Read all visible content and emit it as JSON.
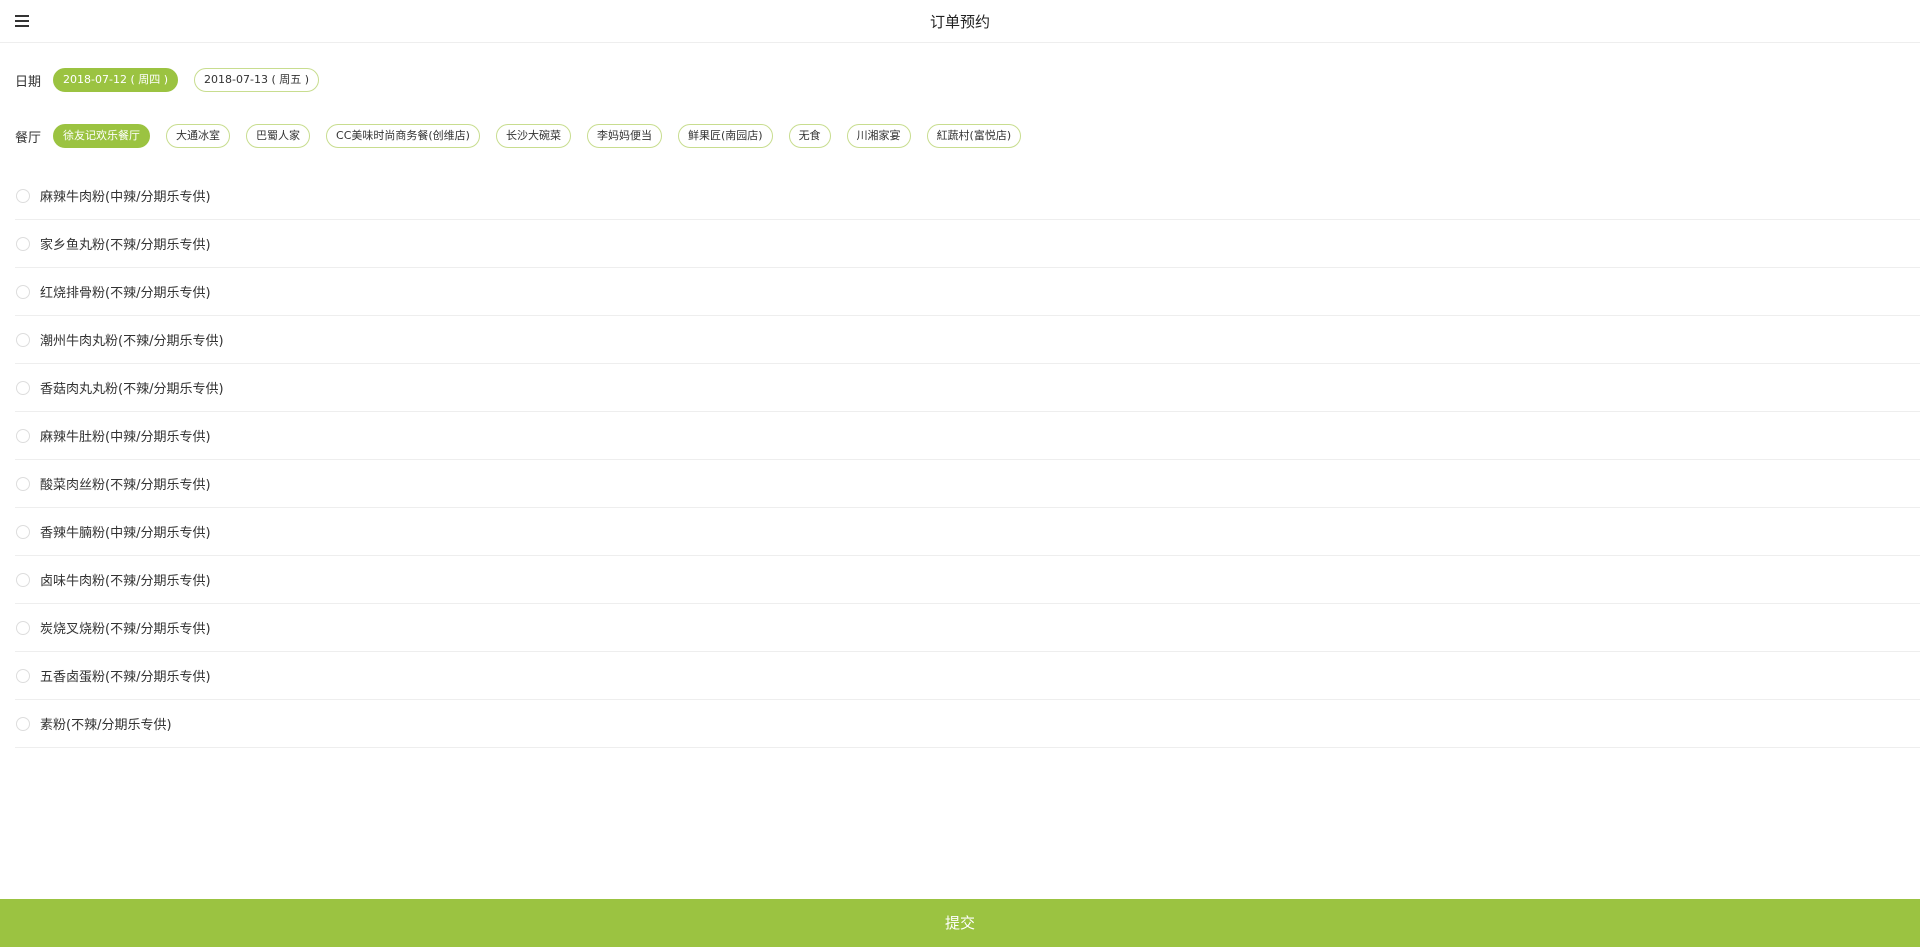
{
  "header": {
    "title": "订单预约"
  },
  "dates": {
    "label": "日期",
    "options": [
      {
        "label": "2018-07-12 ( 周四 )",
        "active": true
      },
      {
        "label": "2018-07-13 ( 周五 )",
        "active": false
      }
    ]
  },
  "restaurants": {
    "label": "餐厅",
    "options": [
      {
        "label": "徐友记欢乐餐厅",
        "active": true
      },
      {
        "label": "大通冰室",
        "active": false
      },
      {
        "label": "巴蜀人家",
        "active": false
      },
      {
        "label": "CC美味时尚商务餐(创维店)",
        "active": false
      },
      {
        "label": "长沙大碗菜",
        "active": false
      },
      {
        "label": "李妈妈便当",
        "active": false
      },
      {
        "label": "鲜果匠(南园店)",
        "active": false
      },
      {
        "label": "无食",
        "active": false
      },
      {
        "label": "川湘家宴",
        "active": false
      },
      {
        "label": "紅蔬村(富悦店)",
        "active": false
      }
    ]
  },
  "dishes": [
    "麻辣牛肉粉(中辣/分期乐专供)",
    "家乡鱼丸粉(不辣/分期乐专供)",
    "红烧排骨粉(不辣/分期乐专供)",
    "潮州牛肉丸粉(不辣/分期乐专供)",
    "香菇肉丸丸粉(不辣/分期乐专供)",
    "麻辣牛肚粉(中辣/分期乐专供)",
    "酸菜肉丝粉(不辣/分期乐专供)",
    "香辣牛腩粉(中辣/分期乐专供)",
    "卤味牛肉粉(不辣/分期乐专供)",
    "炭烧叉烧粉(不辣/分期乐专供)",
    "五香卤蛋粉(不辣/分期乐专供)",
    "素粉(不辣/分期乐专供)"
  ],
  "footer": {
    "submit_label": "提交"
  },
  "colors": {
    "accent": "#9bc341",
    "chip_border": "#c8dd8f",
    "divider": "#eeeeee"
  },
  "icons": {
    "menu": "hamburger-menu-icon",
    "radio": "radio-unchecked-icon"
  }
}
